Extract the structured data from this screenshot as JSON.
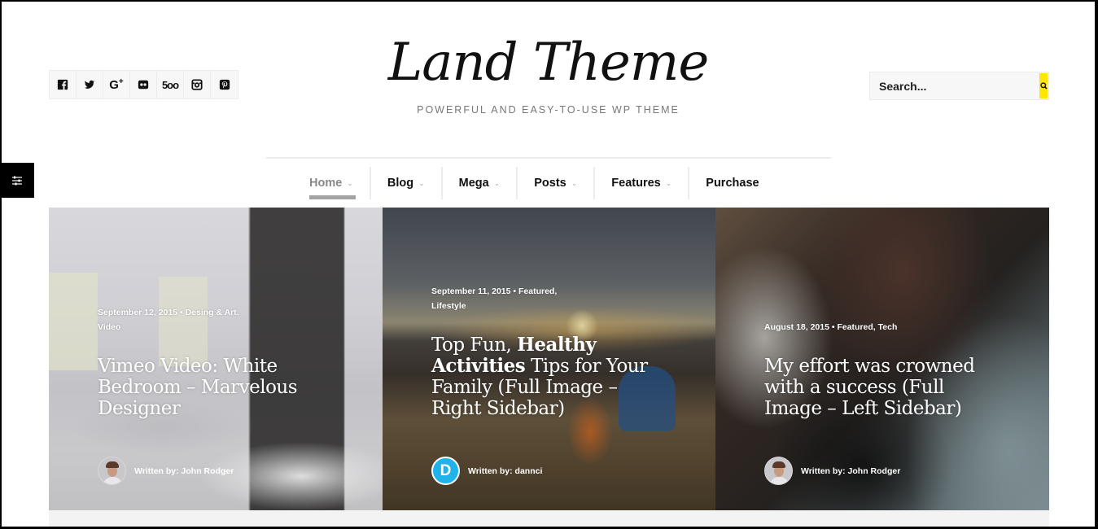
{
  "header": {
    "logo_title": "Land Theme",
    "logo_tagline": "POWERFUL AND EASY-TO-USE WP THEME",
    "social": [
      {
        "name": "facebook",
        "icon": "facebook-icon",
        "glyph": "f"
      },
      {
        "name": "twitter",
        "icon": "twitter-icon",
        "glyph": ""
      },
      {
        "name": "google-plus",
        "icon": "google-plus-icon",
        "glyph": "G+"
      },
      {
        "name": "flickr",
        "icon": "flickr-icon",
        "glyph": ""
      },
      {
        "name": "500px",
        "icon": "500px-icon",
        "glyph": "5oo"
      },
      {
        "name": "instagram",
        "icon": "instagram-icon",
        "glyph": ""
      },
      {
        "name": "pinterest",
        "icon": "pinterest-icon",
        "glyph": ""
      }
    ],
    "search": {
      "placeholder": "Search...",
      "button_icon": "search-icon"
    },
    "accent_color": "#ffe600"
  },
  "side_toggle": {
    "icon": "sliders-icon"
  },
  "nav": {
    "items": [
      {
        "label": "Home",
        "has_dropdown": true,
        "active": true
      },
      {
        "label": "Blog",
        "has_dropdown": true,
        "active": false
      },
      {
        "label": "Mega",
        "has_dropdown": true,
        "active": false
      },
      {
        "label": "Posts",
        "has_dropdown": true,
        "active": false
      },
      {
        "label": "Features",
        "has_dropdown": true,
        "active": false
      },
      {
        "label": "Purchase",
        "has_dropdown": false,
        "active": false
      }
    ],
    "chevron": "⌄"
  },
  "slides": [
    {
      "meta_line1": "September 12, 2015 • Desing & Art,",
      "meta_line2": "Video",
      "title_parts": [
        {
          "text": "Vimeo Video: White Bedroom – Marvelous Designer",
          "bold": false
        }
      ],
      "author": "Written by: John Rodger",
      "avatar": "photo"
    },
    {
      "meta_line1": "September 11, 2015 • Featured,",
      "meta_line2": "Lifestyle",
      "title_parts": [
        {
          "text": "Top Fun, ",
          "bold": false
        },
        {
          "text": "Healthy Activities",
          "bold": true
        },
        {
          "text": " Tips for Your Family (Full Image – Right Sidebar)",
          "bold": false
        }
      ],
      "author": "Written by: dannci",
      "avatar": "D"
    },
    {
      "meta_line1": "August 18, 2015 • Featured, Tech",
      "meta_line2": "",
      "title_parts": [
        {
          "text": "My effort was crowned with a success (Full Image – Left Sidebar)",
          "bold": false
        }
      ],
      "author": "Written by: John Rodger",
      "avatar": "photo"
    }
  ]
}
